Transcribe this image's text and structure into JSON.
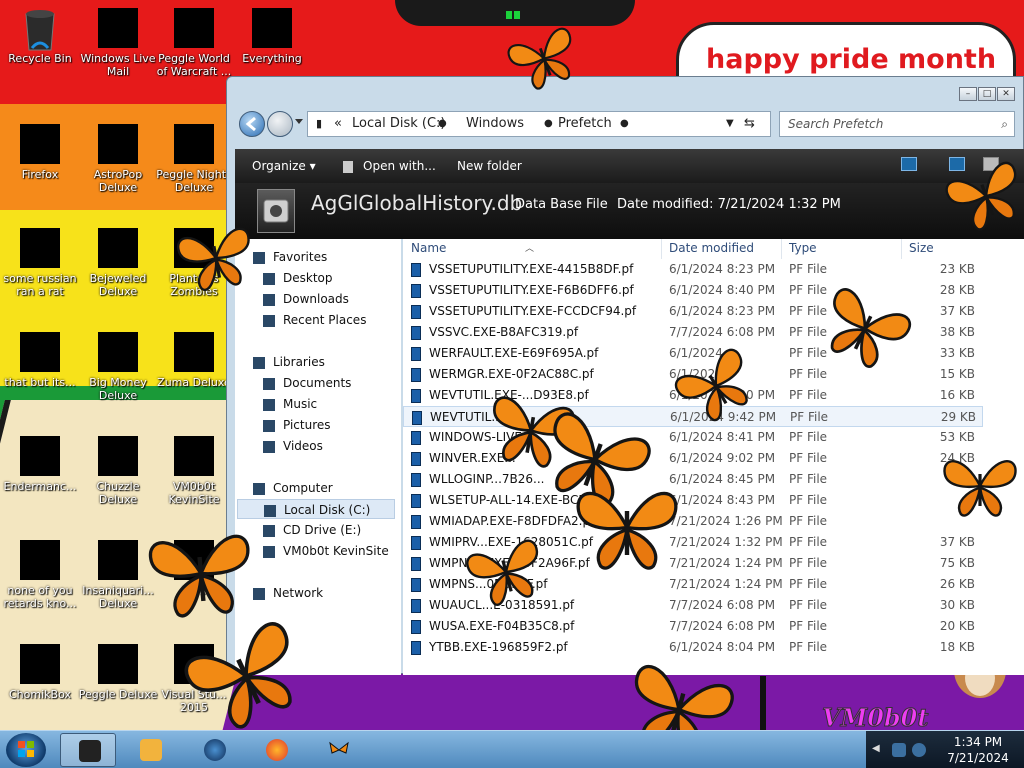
{
  "desktop": {
    "banner_text": "happy pride month",
    "logo_text": "VM0b0t",
    "icons": [
      {
        "label": "Recycle Bin"
      },
      {
        "label": "Windows Live Mail"
      },
      {
        "label": "Peggle World of Warcraft ..."
      },
      {
        "label": "Everything"
      },
      {
        "label": "Firefox"
      },
      {
        "label": "AstroPop Deluxe"
      },
      {
        "label": "Peggle Nights Deluxe"
      },
      {
        "label": "some russian ran a rat"
      },
      {
        "label": "Bejeweled Deluxe"
      },
      {
        "label": "Plants vs Zombies"
      },
      {
        "label": "that but its..."
      },
      {
        "label": "Big Money Deluxe"
      },
      {
        "label": "Zuma Deluxe"
      },
      {
        "label": "Endermanc..."
      },
      {
        "label": "Chuzzle Deluxe"
      },
      {
        "label": "VM0b0t KevinSite"
      },
      {
        "label": "none of you retards kno..."
      },
      {
        "label": "Insaniquari... Deluxe"
      },
      {
        "label": "Ke..."
      },
      {
        "label": "ChomikBox"
      },
      {
        "label": "Peggle Deluxe"
      },
      {
        "label": "Visual Stu... 2015"
      }
    ]
  },
  "explorer": {
    "address": {
      "prefix": "«",
      "crumbs": [
        "Local Disk (C:)",
        "Windows",
        "Prefetch"
      ]
    },
    "search_placeholder": "Search Prefetch",
    "toolbar": {
      "organize": "Organize ▾",
      "open_with": "Open with...",
      "new_folder": "New folder"
    },
    "details": {
      "filename": "AgGlGlobalHistory.db",
      "type": "Data Base File",
      "modified_label": "Date modified:",
      "modified_value": "7/21/2024 1:32 PM"
    },
    "nav": {
      "favorites": "Favorites",
      "desktop": "Desktop",
      "downloads": "Downloads",
      "recent": "Recent Places",
      "libraries": "Libraries",
      "documents": "Documents",
      "music": "Music",
      "pictures": "Pictures",
      "videos": "Videos",
      "computer": "Computer",
      "local_disk": "Local Disk (C:)",
      "cd_drive": "CD Drive (E:)",
      "vmsite": "VM0b0t KevinSite",
      "network": "Network"
    },
    "columns": {
      "name": "Name",
      "date": "Date modified",
      "type": "Type",
      "size": "Size"
    },
    "files": [
      {
        "name": "VSSETUPUTILITY.EXE-4415B8DF.pf",
        "date": "6/1/2024 8:23 PM",
        "type": "PF File",
        "size": "23 KB"
      },
      {
        "name": "VSSETUPUTILITY.EXE-F6B6DFF6.pf",
        "date": "6/1/2024 8:40 PM",
        "type": "PF File",
        "size": "28 KB"
      },
      {
        "name": "VSSETUPUTILITY.EXE-FCCDCF94.pf",
        "date": "6/1/2024 8:23 PM",
        "type": "PF File",
        "size": "37 KB"
      },
      {
        "name": "VSSVC.EXE-B8AFC319.pf",
        "date": "7/7/2024 6:08 PM",
        "type": "PF File",
        "size": "38 KB"
      },
      {
        "name": "WERFAULT.EXE-E69F695A.pf",
        "date": "6/1/2024",
        "type": "PF File",
        "size": "33 KB"
      },
      {
        "name": "WERMGR.EXE-0F2AC88C.pf",
        "date": "6/1/2024",
        "type": "PF File",
        "size": "15 KB"
      },
      {
        "name": "WEVTUTIL.EXE-...D93E8.pf",
        "date": "6/1/2024 8:30 PM",
        "type": "PF File",
        "size": "16 KB"
      },
      {
        "name": "WEVTUTIL.EXE...",
        "date": "6/1/2024 9:42 PM",
        "type": "PF File",
        "size": "29 KB"
      },
      {
        "name": "WINDOWS-LIVE...",
        "date": "6/1/2024 8:41 PM",
        "type": "PF File",
        "size": "53 KB"
      },
      {
        "name": "WINVER.EXE...",
        "date": "6/1/2024 9:02 PM",
        "type": "PF File",
        "size": "24 KB"
      },
      {
        "name": "WLLOGINP...7B26...",
        "date": "6/1/2024 8:45 PM",
        "type": "PF File",
        "size": ""
      },
      {
        "name": "WLSETUP-ALL-14.EXE-BCB6...",
        "date": "6/1/2024 8:43 PM",
        "type": "PF File",
        "size": ""
      },
      {
        "name": "WMIADAP.EXE-F8DFDFA2.pf",
        "date": "7/21/2024 1:26 PM",
        "type": "PF File",
        "size": ""
      },
      {
        "name": "WMIPRV...EXE-1628051C.pf",
        "date": "7/21/2024 1:32 PM",
        "type": "PF File",
        "size": "37 KB"
      },
      {
        "name": "WMPNE...EXE-D0F2A96F.pf",
        "date": "7/21/2024 1:24 PM",
        "type": "PF File",
        "size": "75 KB"
      },
      {
        "name": "WMPNS...0D39BF.pf",
        "date": "7/21/2024 1:24 PM",
        "type": "PF File",
        "size": "26 KB"
      },
      {
        "name": "WUAUCL...E-0318591.pf",
        "date": "7/7/2024 6:08 PM",
        "type": "PF File",
        "size": "30 KB"
      },
      {
        "name": "WUSA.EXE-F04B35C8.pf",
        "date": "7/7/2024 6:08 PM",
        "type": "PF File",
        "size": "20 KB"
      },
      {
        "name": "YTBB.EXE-196859F2.pf",
        "date": "6/1/2024 8:04 PM",
        "type": "PF File",
        "size": "18 KB"
      }
    ]
  },
  "taskbar": {
    "time": "1:34 PM",
    "date": "7/21/2024"
  }
}
